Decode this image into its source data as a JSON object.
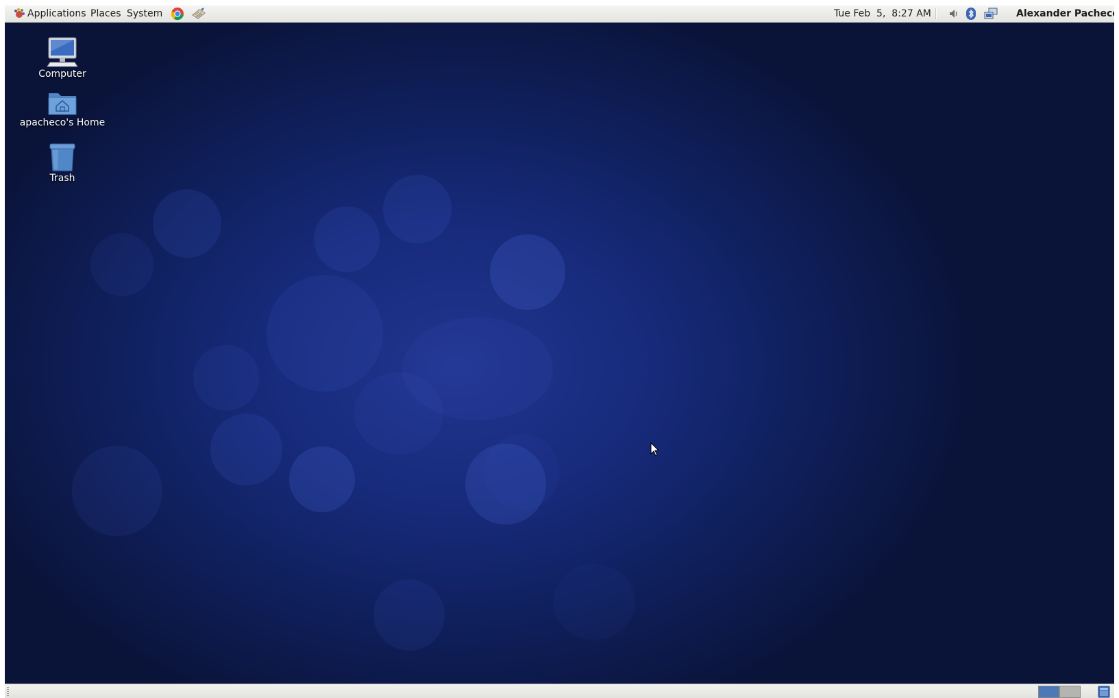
{
  "top_panel": {
    "menus": {
      "applications": "Applications",
      "places": "Places",
      "system": "System"
    },
    "launchers": [
      {
        "name": "chrome-icon"
      },
      {
        "name": "text-editor-icon"
      }
    ],
    "clock": "Tue Feb  5,  8:27 AM",
    "tray_icons": [
      "volume-icon",
      "bluetooth-icon",
      "network-icon"
    ],
    "user_name": "Alexander Pacheco"
  },
  "desktop": {
    "icons": [
      {
        "label": "Computer",
        "icon": "computer-icon"
      },
      {
        "label": "apacheco's Home",
        "icon": "home-folder-icon"
      },
      {
        "label": "Trash",
        "icon": "trash-icon"
      }
    ]
  },
  "bottom_panel": {
    "workspaces": 2,
    "active_workspace": 1
  },
  "colors": {
    "desktop_center": "#20358f",
    "desktop_edge": "#0a1338",
    "panel": "#e8e8e4",
    "workspace_active": "#4f79b6"
  }
}
